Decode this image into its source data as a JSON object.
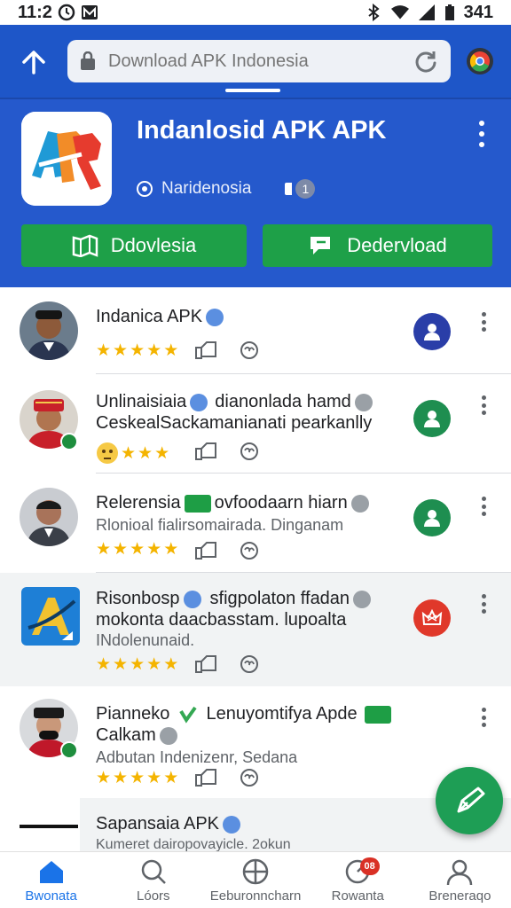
{
  "status_bar": {
    "time": "11:2",
    "battery": "341"
  },
  "browser": {
    "url_placeholder": "Download APK Indonesia"
  },
  "app": {
    "title": "Indanlosid APK APK",
    "developer": "Naridenosia",
    "count": "1",
    "buttons": {
      "primary": "Ddovlesia",
      "secondary": "Dedervload"
    }
  },
  "list": {
    "items": [
      {
        "title": "Indanica APK",
        "line2": "",
        "sub": "",
        "status_color": "#2a3ea8"
      },
      {
        "title": "Unlinaisiaia",
        "title_tail": "dianonlada hamd",
        "line2": "CeskealSackamanianati pearkanlly",
        "sub": "",
        "status_color": "#1e8e50"
      },
      {
        "title": "Relerensia",
        "title_tail": "ovfoodaarn hiarn",
        "line2": "",
        "sub": "Rlonioal fialirsomairada. Dinganam",
        "status_color": "#1e8e50"
      },
      {
        "title": "Risonbosp",
        "title_tail": "sfigpolaton ffadan",
        "line2": "mokonta daacbasstam. lupoalta",
        "sub": "INdolenunaid.",
        "status_color": "#e0382a"
      },
      {
        "title": "Pianneko",
        "title_tail": "Lenuyomtifya Apde",
        "line2": "Calkam",
        "sub": "Adbutan Indenizenr, Sedana"
      },
      {
        "title": "Sapansaia APK",
        "line2": "",
        "sub": "Kumeret dairopovayicle. 2okun"
      }
    ]
  },
  "nav": {
    "items": [
      {
        "label": "Bwonata"
      },
      {
        "label": "Lóors"
      },
      {
        "label": "Eeburonncharn"
      },
      {
        "label": "Rowanta",
        "badge": "08"
      },
      {
        "label": "Breneraqo"
      }
    ]
  },
  "colors": {
    "header_blue": "#1e56c8",
    "hero_blue": "#2559cc",
    "button_green": "#1ea048",
    "star_gold": "#f4b400",
    "nav_active": "#1a73e8"
  }
}
